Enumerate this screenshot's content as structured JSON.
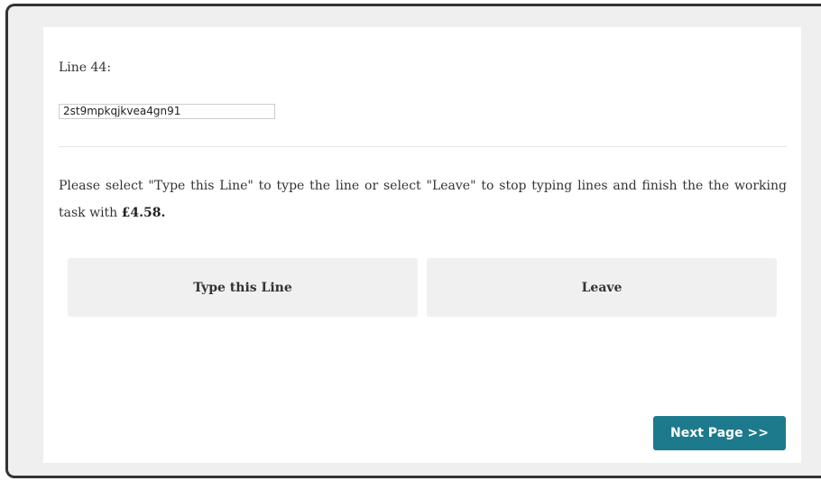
{
  "task": {
    "line_label": "Line 44:",
    "line_value": "2st9mpkqjkvea4gn91",
    "instruction_text": "Please select \"Type this Line\" to type the line or select \"Leave\" to stop typing lines and finish the the working task with ",
    "amount": "£4.58."
  },
  "choices": {
    "type_label": "Type this Line",
    "leave_label": "Leave"
  },
  "navigation": {
    "next_label": "Next Page >>"
  },
  "colors": {
    "next_button": "#1d7a8c",
    "choice_button": "#f0f0f0",
    "frame_background": "#efefef"
  }
}
